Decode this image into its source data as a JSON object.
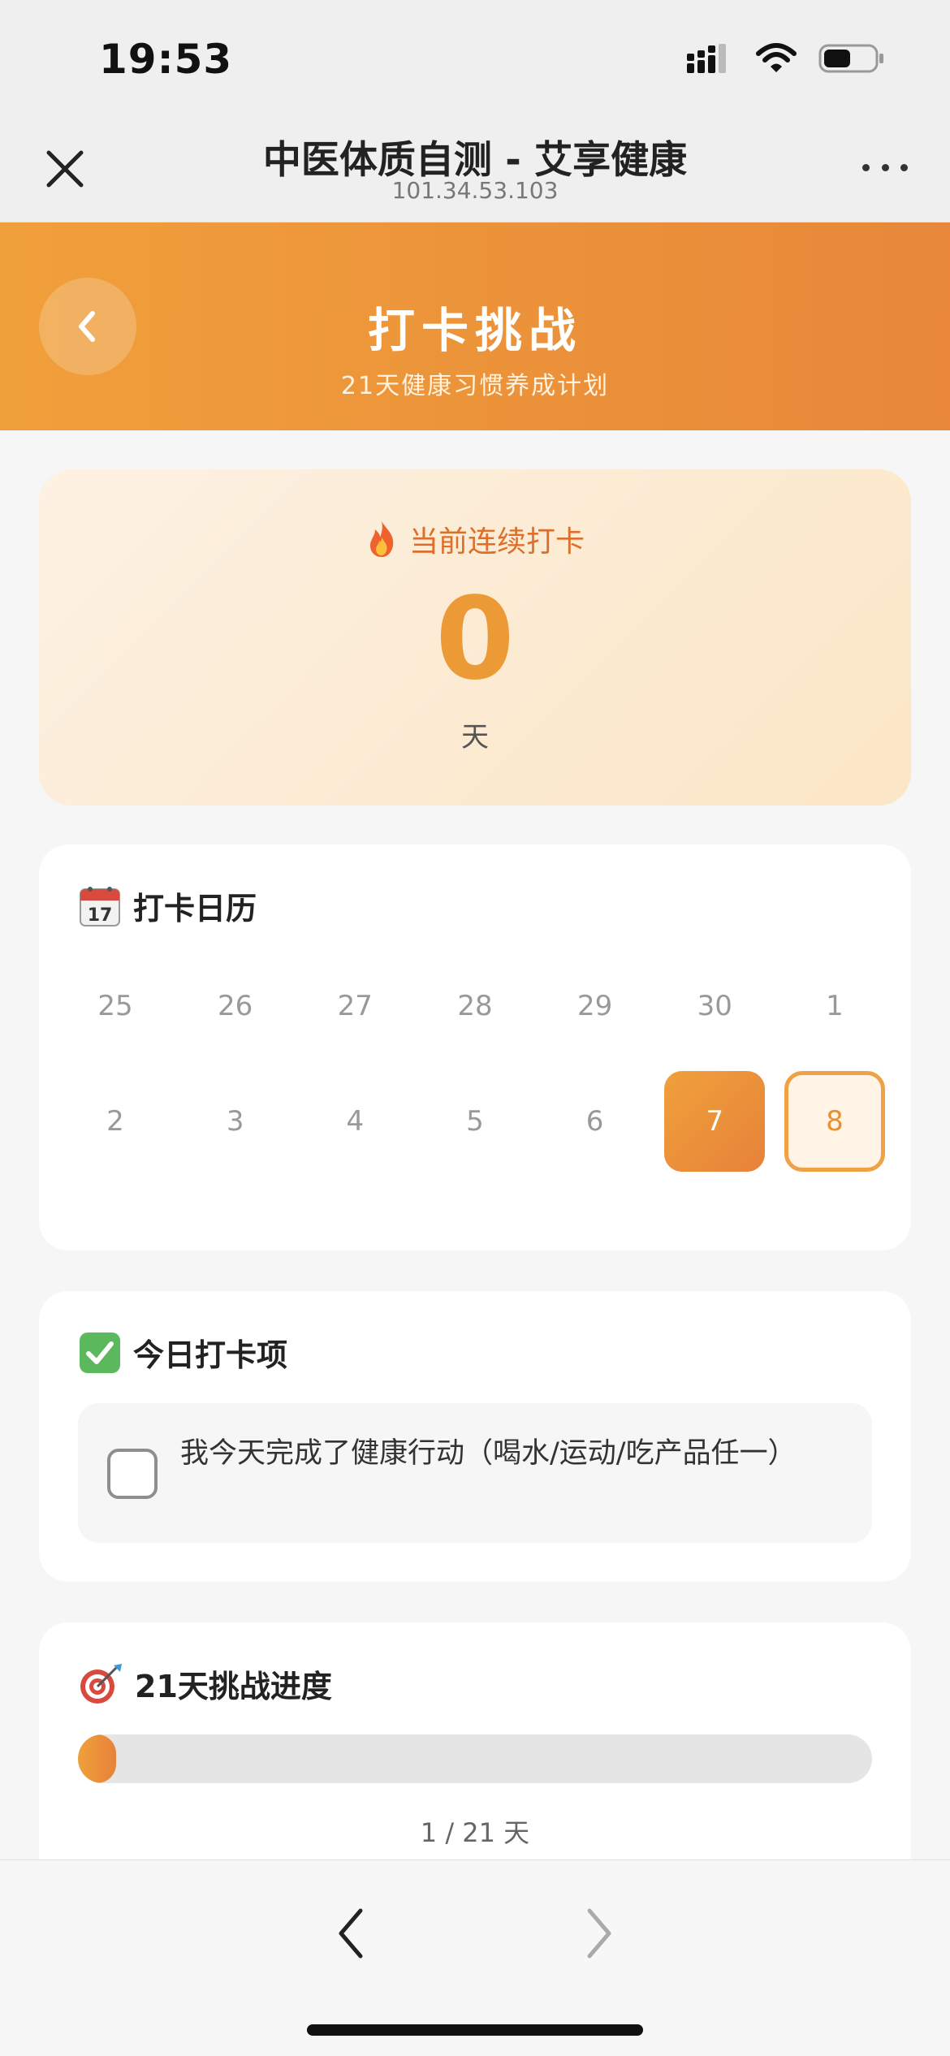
{
  "status_bar": {
    "time": "19:53",
    "icons": [
      "signal-icon",
      "wifi-icon",
      "battery-icon"
    ]
  },
  "browser": {
    "title": "中医体质自测 - 艾享健康",
    "address": "101.34.53.103",
    "close_icon": "close-icon",
    "more_icon": "more-icon"
  },
  "banner": {
    "back_icon": "chevron-left-icon",
    "title": "打卡挑战",
    "subtitle": "21天健康习惯养成计划"
  },
  "streak": {
    "icon": "fire-icon",
    "label": "当前连续打卡",
    "value": "0",
    "unit": "天"
  },
  "calendar": {
    "icon": "calendar-icon",
    "title": "打卡日历",
    "weeks": [
      [
        {
          "day": "25",
          "state": "normal"
        },
        {
          "day": "26",
          "state": "normal"
        },
        {
          "day": "27",
          "state": "normal"
        },
        {
          "day": "28",
          "state": "normal"
        },
        {
          "day": "29",
          "state": "normal"
        },
        {
          "day": "30",
          "state": "normal"
        },
        {
          "day": "1",
          "state": "normal"
        }
      ],
      [
        {
          "day": "2",
          "state": "normal"
        },
        {
          "day": "3",
          "state": "normal"
        },
        {
          "day": "4",
          "state": "normal"
        },
        {
          "day": "5",
          "state": "normal"
        },
        {
          "day": "6",
          "state": "normal"
        },
        {
          "day": "7",
          "state": "done"
        },
        {
          "day": "8",
          "state": "today"
        }
      ]
    ]
  },
  "today_tasks": {
    "icon": "check-mark-icon",
    "title": "今日打卡项",
    "tasks": [
      {
        "text": "我今天完成了健康行动（喝水/运动/吃产品任一）",
        "checked": false
      }
    ]
  },
  "progress": {
    "icon": "target-icon",
    "title": "21天挑战进度",
    "current": 1,
    "total": 21,
    "label": "1 / 21 天"
  },
  "toolbar": {
    "back_icon": "chevron-left-icon",
    "forward_icon": "chevron-right-icon"
  },
  "colors": {
    "accent": "#ec9a36",
    "accent_dark": "#e6823a",
    "streak_label": "#dd6f2a"
  }
}
